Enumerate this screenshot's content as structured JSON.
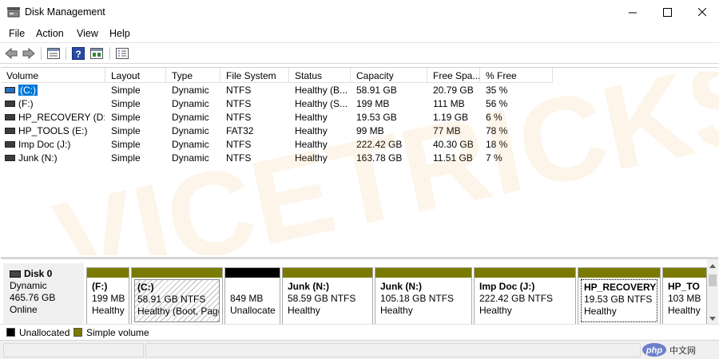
{
  "window": {
    "title": "Disk Management"
  },
  "menu": [
    "File",
    "Action",
    "View",
    "Help"
  ],
  "toolbar": {
    "icons": [
      "back-arrow-icon",
      "forward-arrow-icon",
      "volume-list-icon",
      "help-icon",
      "graphical-view-icon",
      "properties-icon"
    ]
  },
  "volumes": {
    "columns": [
      "Volume",
      "Layout",
      "Type",
      "File System",
      "Status",
      "Capacity",
      "Free Spa...",
      "% Free"
    ],
    "rows": [
      [
        "(C:)",
        "Simple",
        "Dynamic",
        "NTFS",
        "Healthy (B...",
        "58.91 GB",
        "20.79 GB",
        "35 %"
      ],
      [
        "(F:)",
        "Simple",
        "Dynamic",
        "NTFS",
        "Healthy (S...",
        "199 MB",
        "111 MB",
        "56 %"
      ],
      [
        "HP_RECOVERY (D:)",
        "Simple",
        "Dynamic",
        "NTFS",
        "Healthy",
        "19.53 GB",
        "1.19 GB",
        "6 %"
      ],
      [
        "HP_TOOLS (E:)",
        "Simple",
        "Dynamic",
        "FAT32",
        "Healthy",
        "99 MB",
        "77 MB",
        "78 %"
      ],
      [
        "Imp Doc (J:)",
        "Simple",
        "Dynamic",
        "NTFS",
        "Healthy",
        "222.42 GB",
        "40.30 GB",
        "18 %"
      ],
      [
        "Junk (N:)",
        "Simple",
        "Dynamic",
        "NTFS",
        "Healthy",
        "163.78 GB",
        "11.51 GB",
        "7 %"
      ]
    ]
  },
  "watermark": "VICETRICKS",
  "disk": {
    "name": "Disk 0",
    "type": "Dynamic",
    "size": "465.76 GB",
    "state": "Online"
  },
  "partitions": [
    {
      "name": "(F:)",
      "size": "199 MB",
      "status": "Healthy",
      "kind": "simple"
    },
    {
      "name": "(C:)",
      "size": "58.91 GB NTFS",
      "status": "Healthy (Boot, Page",
      "kind": "simple-hatched"
    },
    {
      "name": "",
      "size": "849 MB",
      "status": "Unallocate",
      "kind": "unallocated"
    },
    {
      "name": "Junk  (N:)",
      "size": "58.59 GB NTFS",
      "status": "Healthy",
      "kind": "simple"
    },
    {
      "name": "Junk  (N:)",
      "size": "105.18 GB NTFS",
      "status": "Healthy",
      "kind": "simple"
    },
    {
      "name": "Imp Doc  (J:)",
      "size": "222.42 GB NTFS",
      "status": "Healthy",
      "kind": "simple"
    },
    {
      "name": "HP_RECOVERY  (D:)",
      "size": "19.53 GB NTFS",
      "status": "Healthy",
      "kind": "simple-focused"
    },
    {
      "name": "HP_TO",
      "size": "103 MB",
      "status": "Healthy",
      "kind": "simple"
    }
  ],
  "legend": [
    {
      "label": "Unallocated",
      "color": "#000000"
    },
    {
      "label": "Simple volume",
      "color": "#7a7a00"
    }
  ],
  "badge": {
    "text": "php",
    "suffix": "中文网"
  }
}
